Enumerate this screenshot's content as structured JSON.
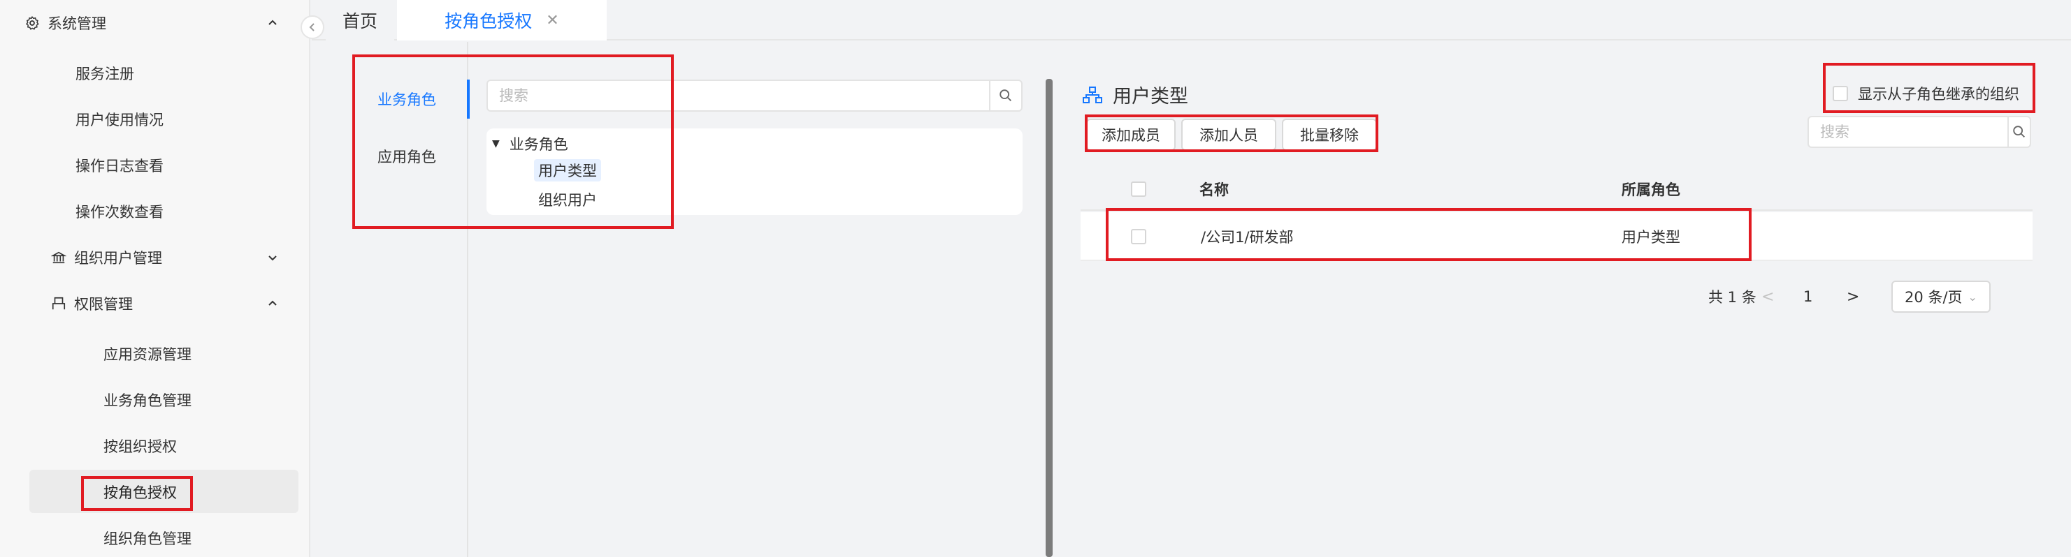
{
  "sidebar": {
    "system": "系统管理",
    "items": {
      "service_register": "服务注册",
      "user_usage": "用户使用情况",
      "op_log": "操作日志查看",
      "op_count": "操作次数查看",
      "org_user_mgmt": "组织用户管理",
      "perm_mgmt": "权限管理"
    },
    "perm_sub": {
      "app_resource": "应用资源管理",
      "business_role": "业务角色管理",
      "by_org": "按组织授权",
      "by_role": "按角色授权",
      "org_role": "组织角色管理"
    }
  },
  "tabs": {
    "home": "首页",
    "active": "按角色授权",
    "close": "✕"
  },
  "left": {
    "role_tabs": {
      "business": "业务角色",
      "app": "应用角色"
    },
    "search_placeholder": "搜索",
    "tree": {
      "root": "业务角色",
      "child1": "用户类型",
      "child2": "组织用户"
    }
  },
  "right": {
    "title": "用户类型",
    "inherit_label": "显示从子角色继承的组织",
    "buttons": {
      "add_member": "添加成员",
      "add_person": "添加人员",
      "batch_remove": "批量移除"
    },
    "search_placeholder": "搜索",
    "table": {
      "headers": {
        "name": "名称",
        "role": "所属角色"
      },
      "rows": [
        {
          "name": "/公司1/研发部",
          "role": "用户类型"
        }
      ]
    },
    "pager": {
      "total": "共 1 条",
      "prev": "<",
      "page": "1",
      "next": ">",
      "size": "20 条/页"
    }
  },
  "colors": {
    "accent": "#1677ff",
    "highlight": "#e11b22"
  }
}
